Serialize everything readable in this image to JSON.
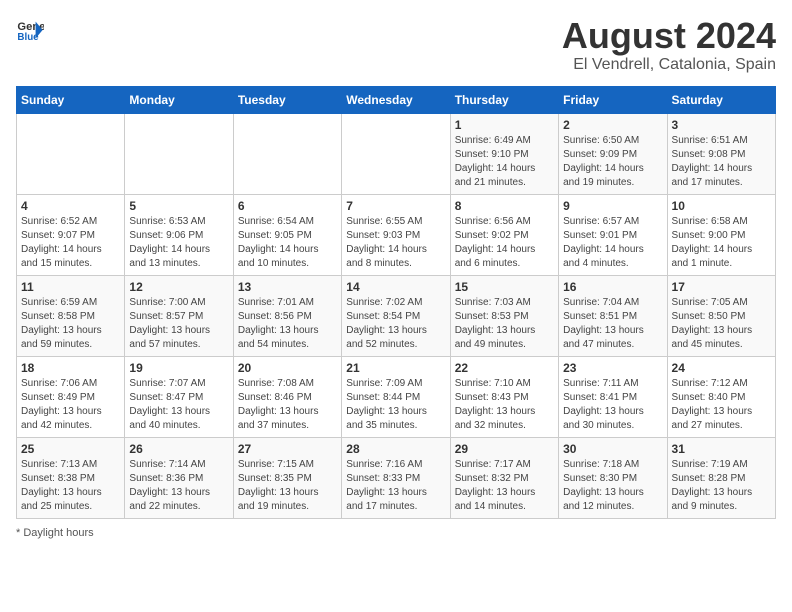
{
  "header": {
    "logo_general": "General",
    "logo_blue": "Blue",
    "title": "August 2024",
    "subtitle": "El Vendrell, Catalonia, Spain"
  },
  "days_of_week": [
    "Sunday",
    "Monday",
    "Tuesday",
    "Wednesday",
    "Thursday",
    "Friday",
    "Saturday"
  ],
  "weeks": [
    [
      {
        "day": "",
        "info": ""
      },
      {
        "day": "",
        "info": ""
      },
      {
        "day": "",
        "info": ""
      },
      {
        "day": "",
        "info": ""
      },
      {
        "day": "1",
        "info": "Sunrise: 6:49 AM\nSunset: 9:10 PM\nDaylight: 14 hours\nand 21 minutes."
      },
      {
        "day": "2",
        "info": "Sunrise: 6:50 AM\nSunset: 9:09 PM\nDaylight: 14 hours\nand 19 minutes."
      },
      {
        "day": "3",
        "info": "Sunrise: 6:51 AM\nSunset: 9:08 PM\nDaylight: 14 hours\nand 17 minutes."
      }
    ],
    [
      {
        "day": "4",
        "info": "Sunrise: 6:52 AM\nSunset: 9:07 PM\nDaylight: 14 hours\nand 15 minutes."
      },
      {
        "day": "5",
        "info": "Sunrise: 6:53 AM\nSunset: 9:06 PM\nDaylight: 14 hours\nand 13 minutes."
      },
      {
        "day": "6",
        "info": "Sunrise: 6:54 AM\nSunset: 9:05 PM\nDaylight: 14 hours\nand 10 minutes."
      },
      {
        "day": "7",
        "info": "Sunrise: 6:55 AM\nSunset: 9:03 PM\nDaylight: 14 hours\nand 8 minutes."
      },
      {
        "day": "8",
        "info": "Sunrise: 6:56 AM\nSunset: 9:02 PM\nDaylight: 14 hours\nand 6 minutes."
      },
      {
        "day": "9",
        "info": "Sunrise: 6:57 AM\nSunset: 9:01 PM\nDaylight: 14 hours\nand 4 minutes."
      },
      {
        "day": "10",
        "info": "Sunrise: 6:58 AM\nSunset: 9:00 PM\nDaylight: 14 hours\nand 1 minute."
      }
    ],
    [
      {
        "day": "11",
        "info": "Sunrise: 6:59 AM\nSunset: 8:58 PM\nDaylight: 13 hours\nand 59 minutes."
      },
      {
        "day": "12",
        "info": "Sunrise: 7:00 AM\nSunset: 8:57 PM\nDaylight: 13 hours\nand 57 minutes."
      },
      {
        "day": "13",
        "info": "Sunrise: 7:01 AM\nSunset: 8:56 PM\nDaylight: 13 hours\nand 54 minutes."
      },
      {
        "day": "14",
        "info": "Sunrise: 7:02 AM\nSunset: 8:54 PM\nDaylight: 13 hours\nand 52 minutes."
      },
      {
        "day": "15",
        "info": "Sunrise: 7:03 AM\nSunset: 8:53 PM\nDaylight: 13 hours\nand 49 minutes."
      },
      {
        "day": "16",
        "info": "Sunrise: 7:04 AM\nSunset: 8:51 PM\nDaylight: 13 hours\nand 47 minutes."
      },
      {
        "day": "17",
        "info": "Sunrise: 7:05 AM\nSunset: 8:50 PM\nDaylight: 13 hours\nand 45 minutes."
      }
    ],
    [
      {
        "day": "18",
        "info": "Sunrise: 7:06 AM\nSunset: 8:49 PM\nDaylight: 13 hours\nand 42 minutes."
      },
      {
        "day": "19",
        "info": "Sunrise: 7:07 AM\nSunset: 8:47 PM\nDaylight: 13 hours\nand 40 minutes."
      },
      {
        "day": "20",
        "info": "Sunrise: 7:08 AM\nSunset: 8:46 PM\nDaylight: 13 hours\nand 37 minutes."
      },
      {
        "day": "21",
        "info": "Sunrise: 7:09 AM\nSunset: 8:44 PM\nDaylight: 13 hours\nand 35 minutes."
      },
      {
        "day": "22",
        "info": "Sunrise: 7:10 AM\nSunset: 8:43 PM\nDaylight: 13 hours\nand 32 minutes."
      },
      {
        "day": "23",
        "info": "Sunrise: 7:11 AM\nSunset: 8:41 PM\nDaylight: 13 hours\nand 30 minutes."
      },
      {
        "day": "24",
        "info": "Sunrise: 7:12 AM\nSunset: 8:40 PM\nDaylight: 13 hours\nand 27 minutes."
      }
    ],
    [
      {
        "day": "25",
        "info": "Sunrise: 7:13 AM\nSunset: 8:38 PM\nDaylight: 13 hours\nand 25 minutes."
      },
      {
        "day": "26",
        "info": "Sunrise: 7:14 AM\nSunset: 8:36 PM\nDaylight: 13 hours\nand 22 minutes."
      },
      {
        "day": "27",
        "info": "Sunrise: 7:15 AM\nSunset: 8:35 PM\nDaylight: 13 hours\nand 19 minutes."
      },
      {
        "day": "28",
        "info": "Sunrise: 7:16 AM\nSunset: 8:33 PM\nDaylight: 13 hours\nand 17 minutes."
      },
      {
        "day": "29",
        "info": "Sunrise: 7:17 AM\nSunset: 8:32 PM\nDaylight: 13 hours\nand 14 minutes."
      },
      {
        "day": "30",
        "info": "Sunrise: 7:18 AM\nSunset: 8:30 PM\nDaylight: 13 hours\nand 12 minutes."
      },
      {
        "day": "31",
        "info": "Sunrise: 7:19 AM\nSunset: 8:28 PM\nDaylight: 13 hours\nand 9 minutes."
      }
    ]
  ],
  "footer": {
    "note": "Daylight hours"
  }
}
